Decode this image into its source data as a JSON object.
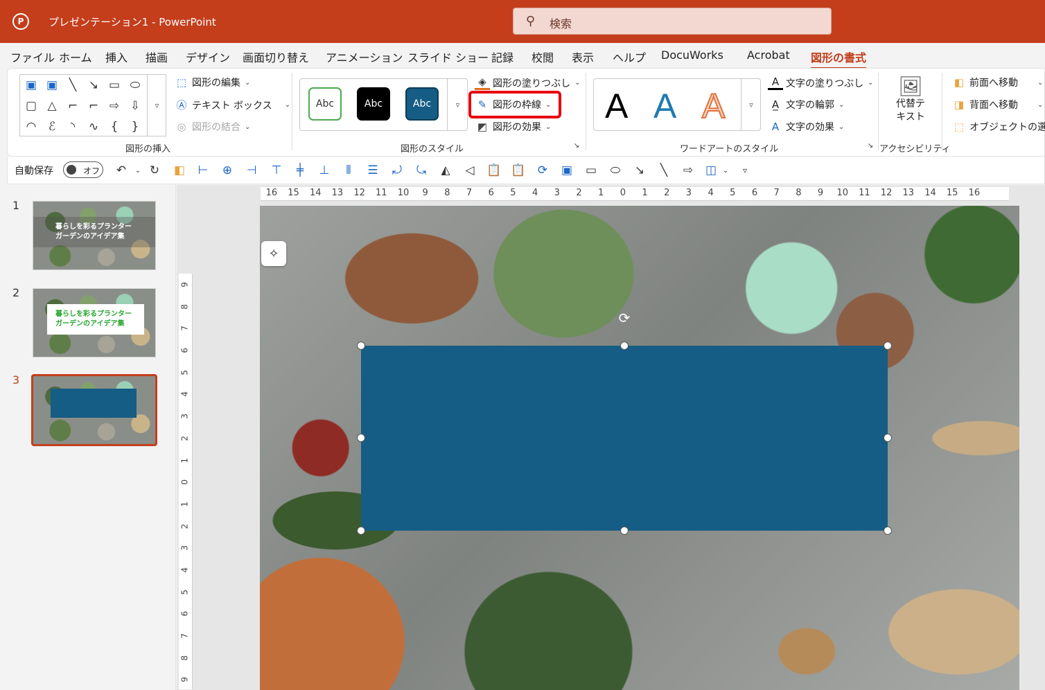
{
  "titlebar": {
    "doc_title": "プレゼンテーション1  -  PowerPoint",
    "search_placeholder": "検索"
  },
  "menu_tabs": [
    "ファイル",
    "ホーム",
    "挿入",
    "描画",
    "デザイン",
    "画面切り替え",
    "アニメーション",
    "スライド ショー",
    "記録",
    "校閲",
    "表示",
    "ヘルプ",
    "DocuWorks",
    "Acrobat",
    "図形の書式"
  ],
  "active_tab": "図形の書式",
  "ribbon": {
    "insert_shapes": {
      "label": "図形の挿入",
      "edit_shape": "図形の編集",
      "text_box": "テキスト ボックス",
      "merge_shapes": "図形の結合"
    },
    "shape_styles": {
      "label": "図形のスタイル",
      "swatch_text": "Abc",
      "fill": "図形の塗りつぶし",
      "outline": "図形の枠線",
      "effects": "図形の効果"
    },
    "wordart": {
      "label": "ワードアートのスタイル",
      "letter": "A",
      "text_fill": "文字の塗りつぶし",
      "text_outline": "文字の輪郭",
      "text_effects": "文字の効果"
    },
    "accessibility": {
      "label": "アクセシビリティ",
      "alt_text_line1": "代替テ",
      "alt_text_line2": "キスト"
    },
    "arrange": {
      "bring_forward": "前面へ移動",
      "send_backward": "背面へ移動",
      "selection_pane": "オブジェクトの選択と"
    }
  },
  "qat": {
    "autosave": "自動保存",
    "toggle": "オフ"
  },
  "slides": [
    {
      "num": "1",
      "line1": "暮らしを彩るプランター",
      "line2": "ガーデンのアイデア集"
    },
    {
      "num": "2",
      "line1": "暮らしを彩るプランター",
      "line2": "ガーデンのアイデア集"
    },
    {
      "num": "3"
    }
  ],
  "ruler_h": [
    "16",
    "15",
    "14",
    "13",
    "12",
    "11",
    "10",
    "9",
    "8",
    "7",
    "6",
    "5",
    "4",
    "3",
    "2",
    "1",
    "0",
    "1",
    "2",
    "3",
    "4",
    "5",
    "6",
    "7",
    "8",
    "9",
    "10",
    "11",
    "12",
    "13",
    "14",
    "15",
    "16"
  ],
  "ruler_v": [
    "9",
    "8",
    "7",
    "6",
    "5",
    "4",
    "3",
    "2",
    "1",
    "0",
    "1",
    "2",
    "3",
    "4",
    "5",
    "6",
    "7",
    "8",
    "9"
  ],
  "colors": {
    "accent": "#c43e1c",
    "shape_fill": "#155d84",
    "highlight": "#e8000d"
  }
}
